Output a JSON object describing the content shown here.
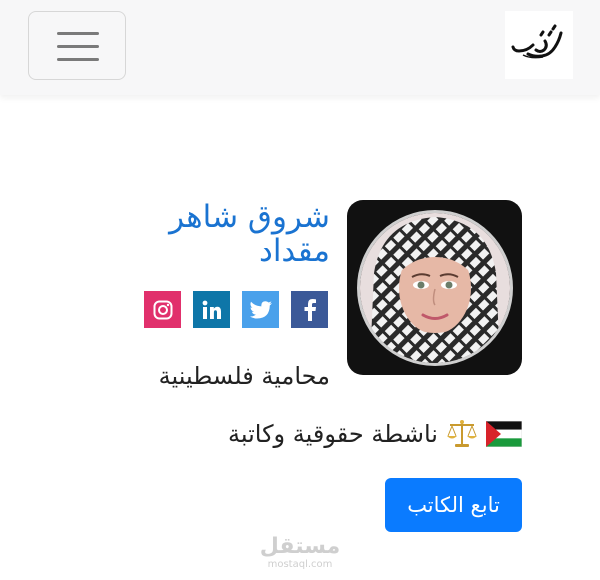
{
  "navbar": {
    "toggler_icon": "hamburger-menu-icon",
    "logo_text": "جولك",
    "bg_color": "#f7f7f8"
  },
  "profile": {
    "name_line1": "شروق شاهر",
    "name_line2": "مقداد",
    "job_title": "محامية فلسطينية",
    "bio": "ناشطة حقوقية وكاتبة",
    "bio_icons": [
      "palestine-flag-icon",
      "scales-icon"
    ],
    "name_color": "#1a73d1"
  },
  "social": [
    {
      "name": "facebook",
      "icon": "facebook-icon",
      "color": "#3b5998"
    },
    {
      "name": "twitter",
      "icon": "twitter-icon",
      "color": "#4aa1eb"
    },
    {
      "name": "linkedin",
      "icon": "linkedin-icon",
      "color": "#0e76a8"
    },
    {
      "name": "instagram",
      "icon": "instagram-icon",
      "color": "#e1306c"
    }
  ],
  "follow_button": {
    "label": "تابع الكاتب",
    "color": "#0a7bff"
  },
  "watermark": {
    "arabic": "مستقل",
    "url": "mostaql.com"
  }
}
